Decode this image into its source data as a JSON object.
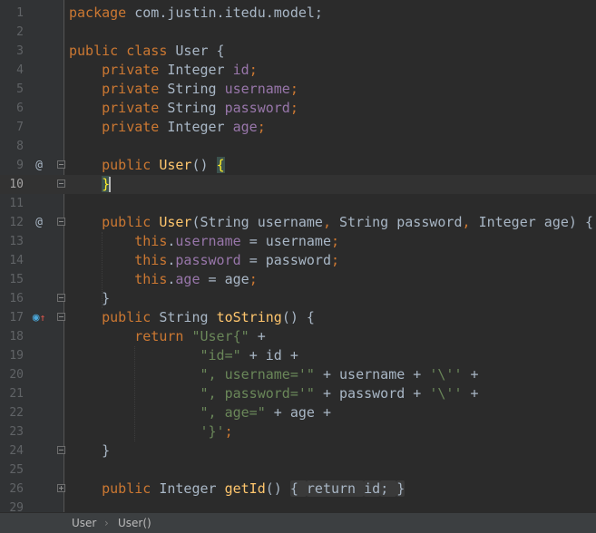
{
  "editor": {
    "current_line": 10,
    "lines": [
      {
        "num": "1",
        "tokens": [
          [
            "kw",
            "package "
          ],
          [
            "p",
            "com.justin.itedu.model;"
          ]
        ]
      },
      {
        "num": "2",
        "tokens": []
      },
      {
        "num": "3",
        "tokens": [
          [
            "kw",
            "public class "
          ],
          [
            "p",
            "User {"
          ]
        ]
      },
      {
        "num": "4",
        "tokens": [
          [
            "p",
            "    "
          ],
          [
            "kw",
            "private "
          ],
          [
            "p",
            "Integer "
          ],
          [
            "fld",
            "id"
          ],
          [
            "kw",
            ";"
          ]
        ]
      },
      {
        "num": "5",
        "tokens": [
          [
            "p",
            "    "
          ],
          [
            "kw",
            "private "
          ],
          [
            "p",
            "String "
          ],
          [
            "fld",
            "username"
          ],
          [
            "kw",
            ";"
          ]
        ]
      },
      {
        "num": "6",
        "tokens": [
          [
            "p",
            "    "
          ],
          [
            "kw",
            "private "
          ],
          [
            "p",
            "String "
          ],
          [
            "fld",
            "password"
          ],
          [
            "kw",
            ";"
          ]
        ]
      },
      {
        "num": "7",
        "tokens": [
          [
            "p",
            "    "
          ],
          [
            "kw",
            "private "
          ],
          [
            "p",
            "Integer "
          ],
          [
            "fld",
            "age"
          ],
          [
            "kw",
            ";"
          ]
        ]
      },
      {
        "num": "8",
        "tokens": []
      },
      {
        "num": "9",
        "icon": "@",
        "fold": "open",
        "tokens": [
          [
            "p",
            "    "
          ],
          [
            "kw",
            "public "
          ],
          [
            "fn",
            "User"
          ],
          [
            "p",
            "() "
          ],
          [
            "hl",
            "{"
          ]
        ]
      },
      {
        "num": "10",
        "fold": "open",
        "tokens": [
          [
            "p",
            "    "
          ],
          [
            "hl",
            "}"
          ],
          [
            "caret",
            ""
          ]
        ]
      },
      {
        "num": "11",
        "tokens": []
      },
      {
        "num": "12",
        "icon": "@",
        "fold": "open",
        "tokens": [
          [
            "p",
            "    "
          ],
          [
            "kw",
            "public "
          ],
          [
            "fn",
            "User"
          ],
          [
            "p",
            "(String username"
          ],
          [
            "kw",
            ", "
          ],
          [
            "p",
            "String password"
          ],
          [
            "kw",
            ", "
          ],
          [
            "p",
            "Integer age) {"
          ]
        ]
      },
      {
        "num": "13",
        "tokens": [
          [
            "p",
            "        "
          ],
          [
            "kw",
            "this"
          ],
          [
            "p",
            "."
          ],
          [
            "fld",
            "username "
          ],
          [
            "p",
            "= username"
          ],
          [
            "kw",
            ";"
          ]
        ]
      },
      {
        "num": "14",
        "tokens": [
          [
            "p",
            "        "
          ],
          [
            "kw",
            "this"
          ],
          [
            "p",
            "."
          ],
          [
            "fld",
            "password "
          ],
          [
            "p",
            "= password"
          ],
          [
            "kw",
            ";"
          ]
        ]
      },
      {
        "num": "15",
        "tokens": [
          [
            "p",
            "        "
          ],
          [
            "kw",
            "this"
          ],
          [
            "p",
            "."
          ],
          [
            "fld",
            "age "
          ],
          [
            "p",
            "= age"
          ],
          [
            "kw",
            ";"
          ]
        ]
      },
      {
        "num": "16",
        "fold": "open",
        "tokens": [
          [
            "p",
            "    }"
          ]
        ]
      },
      {
        "num": "17",
        "icon": "override",
        "fold": "open",
        "tokens": [
          [
            "p",
            "    "
          ],
          [
            "kw",
            "public "
          ],
          [
            "p",
            "String "
          ],
          [
            "fn",
            "toString"
          ],
          [
            "p",
            "() {"
          ]
        ]
      },
      {
        "num": "18",
        "tokens": [
          [
            "p",
            "        "
          ],
          [
            "kw",
            "return "
          ],
          [
            "str",
            "\"User{\" "
          ],
          [
            "p",
            "+"
          ]
        ]
      },
      {
        "num": "19",
        "tokens": [
          [
            "p",
            "                "
          ],
          [
            "str",
            "\"id=\" "
          ],
          [
            "p",
            "+ id +"
          ]
        ]
      },
      {
        "num": "20",
        "tokens": [
          [
            "p",
            "                "
          ],
          [
            "str",
            "\", username='\" "
          ],
          [
            "p",
            "+ username + "
          ],
          [
            "str",
            "'\\'' "
          ],
          [
            "p",
            "+"
          ]
        ]
      },
      {
        "num": "21",
        "tokens": [
          [
            "p",
            "                "
          ],
          [
            "str",
            "\", password='\" "
          ],
          [
            "p",
            "+ password + "
          ],
          [
            "str",
            "'\\'' "
          ],
          [
            "p",
            "+"
          ]
        ]
      },
      {
        "num": "22",
        "tokens": [
          [
            "p",
            "                "
          ],
          [
            "str",
            "\", age=\" "
          ],
          [
            "p",
            "+ age +"
          ]
        ]
      },
      {
        "num": "23",
        "tokens": [
          [
            "p",
            "                "
          ],
          [
            "str",
            "'}'"
          ],
          [
            "kw",
            ";"
          ]
        ]
      },
      {
        "num": "24",
        "fold": "open",
        "tokens": [
          [
            "p",
            "    }"
          ]
        ]
      },
      {
        "num": "25",
        "tokens": []
      },
      {
        "num": "26",
        "fold": "plus",
        "tokens": [
          [
            "p",
            "    "
          ],
          [
            "kw",
            "public "
          ],
          [
            "p",
            "Integer "
          ],
          [
            "fn",
            "getId"
          ],
          [
            "p",
            "() "
          ],
          [
            "fb",
            "{ "
          ],
          [
            "kwfb",
            "return "
          ],
          [
            "fb",
            "id"
          ],
          [
            "kwfb",
            "; "
          ],
          [
            "fb",
            "}"
          ]
        ]
      },
      {
        "num": "29",
        "tokens": []
      }
    ]
  },
  "breadcrumb": {
    "items": [
      "User",
      "User()"
    ],
    "separator": "›"
  },
  "colors": {
    "keyword": "#cc7832",
    "field": "#9876aa",
    "string": "#6a8759",
    "method": "#ffc66d",
    "text": "#a9b7c6",
    "background": "#2b2b2b"
  }
}
